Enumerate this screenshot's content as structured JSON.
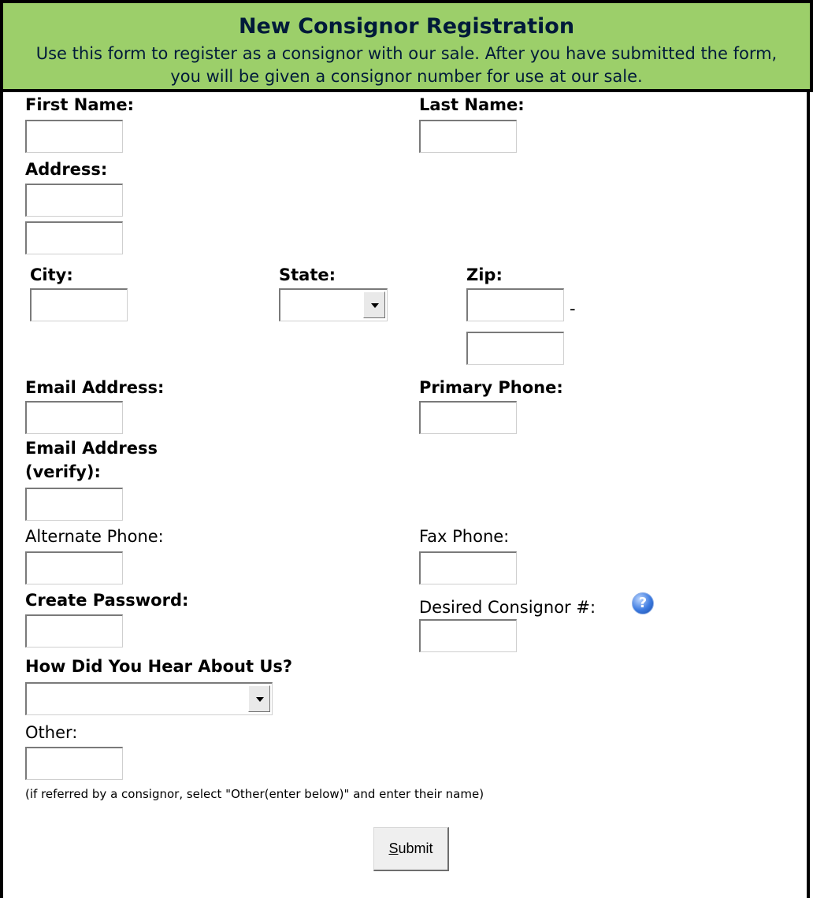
{
  "header": {
    "title": "New Consignor Registration",
    "description": "Use this form to register as a consignor with our sale. After you have submitted the form, you will be given a consignor number for use at our sale."
  },
  "fields": {
    "first_name": "First Name:",
    "last_name": "Last Name:",
    "address": "Address:",
    "city": "City:",
    "state": "State:",
    "zip": "Zip:",
    "zip_sep": "-",
    "email": "Email Address:",
    "primary_phone": "Primary Phone:",
    "email_verify_line1": "Email Address",
    "email_verify_line2": "(verify):",
    "alternate_phone": "Alternate Phone:",
    "fax_phone": "Fax Phone:",
    "create_password": "Create Password:",
    "desired_consignor": "Desired Consignor #:",
    "how_heard": "How Did You Hear About Us?",
    "other": "Other:",
    "referral_note": "(if referred by a consignor, select \"Other(enter below)\" and enter their name)"
  },
  "help_icon": "question-help-icon",
  "submit": {
    "underline_char": "S",
    "rest": "ubmit"
  },
  "colors": {
    "header_bg": "#9ccf6a"
  }
}
